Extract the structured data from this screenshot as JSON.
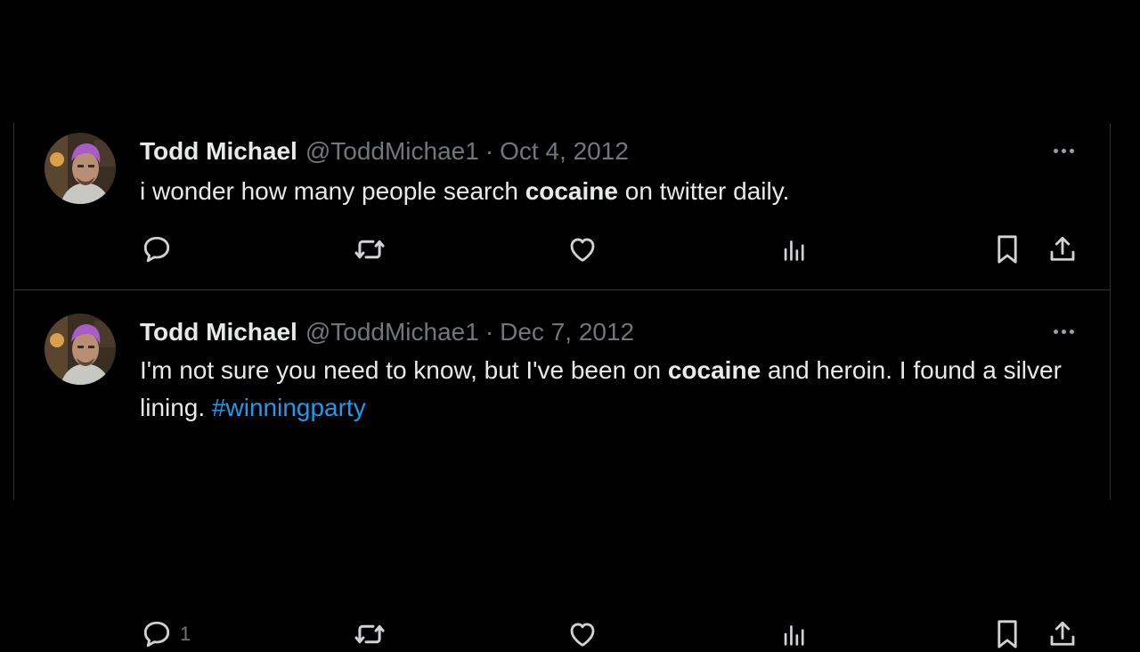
{
  "tweets": [
    {
      "display_name": "Todd Michael",
      "handle": "@ToddMichae1",
      "separator": "·",
      "date": "Oct 4, 2012",
      "text_before": "i wonder how many people search ",
      "text_bold": "cocaine",
      "text_after": " on twitter daily.",
      "reply_count": ""
    },
    {
      "display_name": "Todd Michael",
      "handle": "@ToddMichae1",
      "separator": "·",
      "date": "Dec 7, 2012",
      "text_before": "I'm not sure you need to know, but I've been on ",
      "text_bold": "cocaine",
      "text_after": " and heroin. I found a silver lining. ",
      "hashtag": "#winningparty",
      "reply_count": "1"
    }
  ],
  "icons": [
    "reply-icon",
    "retweet-icon",
    "like-icon",
    "views-icon",
    "bookmark-icon",
    "share-icon",
    "more-icon"
  ],
  "colors": {
    "background": "#000000",
    "text": "#e7e9ea",
    "secondary": "#71767b",
    "link": "#1d9bf0",
    "divider": "#2f3336"
  }
}
